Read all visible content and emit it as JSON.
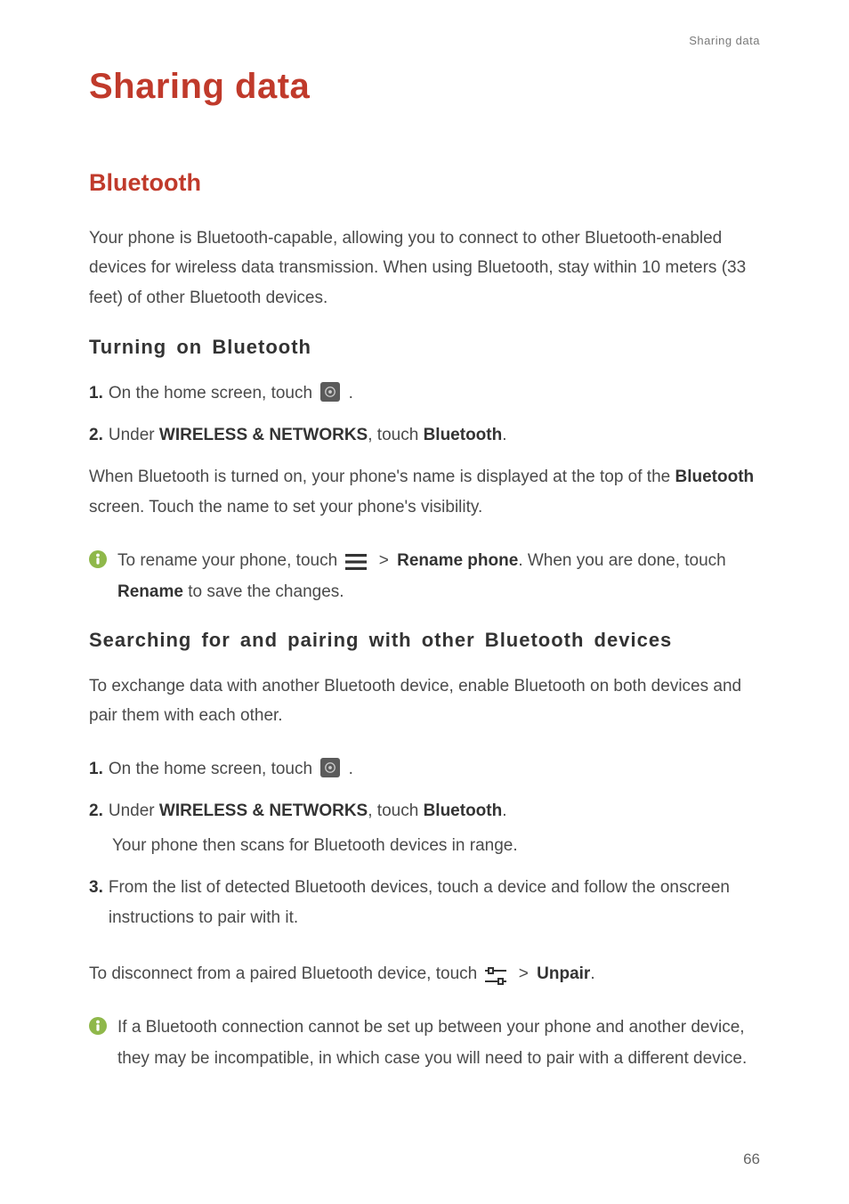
{
  "running_header": "Sharing data",
  "chapter_title": "Sharing data",
  "section_title": "Bluetooth",
  "intro": "Your phone is Bluetooth-capable, allowing you to connect to other Bluetooth-enabled devices for wireless data transmission. When using Bluetooth, stay within 10 meters (33 feet) of other Bluetooth devices.",
  "sub1": {
    "title": "Turning on Bluetooth",
    "step1_num": "1.",
    "step1_a": "On the home screen, touch ",
    "step1_b": ".",
    "step2_num": "2.",
    "step2_a": "Under ",
    "step2_b": "WIRELESS & NETWORKS",
    "step2_c": ", touch ",
    "step2_d": "Bluetooth",
    "step2_e": ".",
    "result_a": "When Bluetooth is turned on, your phone's name is displayed at the top of the ",
    "result_b": "Bluetooth",
    "result_c": " screen. Touch the name to set your phone's visibility.",
    "note_a": "To rename your phone, touch ",
    "note_gt": ">",
    "note_b": "Rename phone",
    "note_c": ". When you are done, touch ",
    "note_d": "Rename",
    "note_e": " to save the changes."
  },
  "sub2": {
    "title": "Searching for and pairing with other Bluetooth devices",
    "intro": "To exchange data with another Bluetooth device, enable Bluetooth on both devices and pair them with each other.",
    "step1_num": "1.",
    "step1_a": "On the home screen, touch ",
    "step1_b": ".",
    "step2_num": "2.",
    "step2_a": "Under ",
    "step2_b": "WIRELESS & NETWORKS",
    "step2_c": ", touch ",
    "step2_d": "Bluetooth",
    "step2_e": ".",
    "step2_sub": "Your phone then scans for Bluetooth devices in range.",
    "step3_num": "3.",
    "step3": "From the list of detected Bluetooth devices, touch a device and follow the onscreen instructions to pair with it.",
    "disc_a": "To disconnect from a paired Bluetooth device, touch ",
    "disc_gt": ">",
    "disc_b": "Unpair",
    "disc_c": ".",
    "note": "If a Bluetooth connection cannot be set up between your phone and another device, they may be incompatible, in which case you will need to pair with a different device."
  },
  "page_number": "66"
}
